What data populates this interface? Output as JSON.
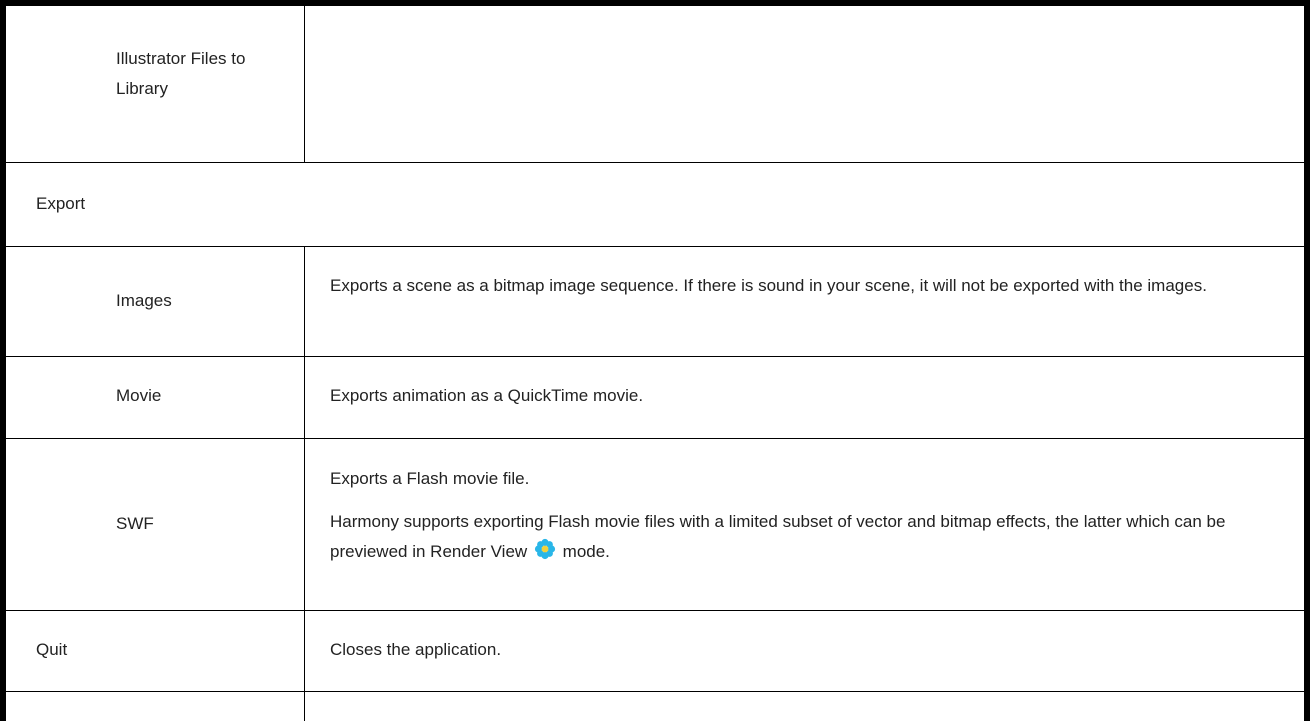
{
  "rows": [
    {
      "label": "Illustrator Files to Library",
      "description": []
    },
    {
      "section": "Export"
    },
    {
      "label": "Images",
      "description": [
        "Exports a scene as a bitmap image sequence. If there is sound in your scene, it will not be exported with the images."
      ]
    },
    {
      "label": "Movie",
      "description": [
        "Exports animation as a QuickTime movie."
      ]
    },
    {
      "label": "SWF",
      "description": [
        "Exports a Flash movie file.",
        "Harmony supports exporting Flash movie files with a limited subset of vector and bitmap effects, the latter which can be previewed in Render View",
        "mode."
      ]
    },
    {
      "label": "Quit",
      "description": [
        "Closes the application."
      ]
    }
  ],
  "icons": {
    "render_view": "render-view-icon",
    "render_view_color": "#29b6e8",
    "render_view_center": "#f2d13a"
  }
}
